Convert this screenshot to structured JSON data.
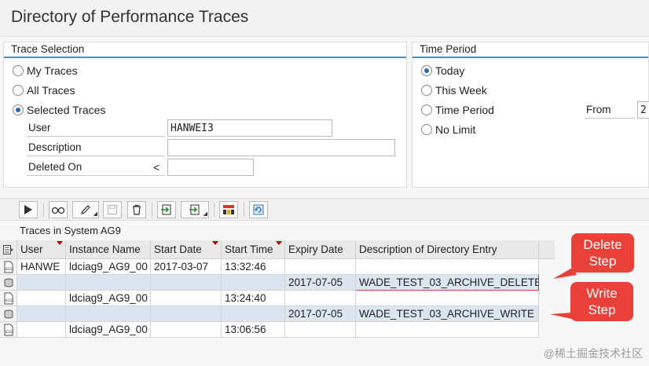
{
  "page": {
    "title": "Directory of Performance Traces"
  },
  "trace_selection": {
    "title": "Trace Selection",
    "options": [
      {
        "label": "My Traces",
        "checked": false
      },
      {
        "label": "All Traces",
        "checked": false
      },
      {
        "label": "Selected Traces",
        "checked": true
      }
    ],
    "fields": {
      "user_label": "User",
      "user_value": "HANWEI3",
      "description_label": "Description",
      "description_value": "",
      "deleted_on_label": "Deleted On",
      "deleted_on_operator": "<",
      "deleted_on_value": ""
    }
  },
  "time_period": {
    "title": "Time Period",
    "options": [
      {
        "label": "Today",
        "checked": true
      },
      {
        "label": "This Week",
        "checked": false
      },
      {
        "label": "Time Period",
        "checked": false
      },
      {
        "label": "No Limit",
        "checked": false
      }
    ],
    "from_label": "From",
    "from_value": "2"
  },
  "toolbar": {
    "buttons": [
      "execute-icon",
      "display-icon",
      "edit-icon",
      "save-icon",
      "delete-icon",
      "export-icon",
      "export-menu-icon",
      "layout-icon",
      "refresh-icon"
    ]
  },
  "traces": {
    "label": "Traces in System AG9",
    "columns": [
      "User",
      "Instance Name",
      "Start Date",
      "Start Time",
      "Expiry Date",
      "Description of Directory Entry"
    ],
    "rows": [
      {
        "user": "HANWE",
        "instance": "ldciag9_AG9_00",
        "start_date": "2017-03-07",
        "start_time": "13:32:46",
        "expiry": "",
        "description": "",
        "icon": "file-0110-icon"
      },
      {
        "user": "",
        "instance": "",
        "start_date": "",
        "start_time": "",
        "expiry": "2017-07-05",
        "description": "WADE_TEST_03_ARCHIVE_DELETE",
        "icon": "database-icon"
      },
      {
        "user": "",
        "instance": "ldciag9_AG9_00",
        "start_date": "",
        "start_time": "13:24:40",
        "expiry": "",
        "description": "",
        "icon": "file-0110-icon"
      },
      {
        "user": "",
        "instance": "",
        "start_date": "",
        "start_time": "",
        "expiry": "2017-07-05",
        "description": "WADE_TEST_03_ARCHIVE_WRITE",
        "icon": "database-icon"
      },
      {
        "user": "",
        "instance": "ldciag9_AG9_00",
        "start_date": "",
        "start_time": "13:06:56",
        "expiry": "",
        "description": "",
        "icon": "file-0110-icon"
      }
    ]
  },
  "callouts": {
    "delete": "Delete Step",
    "write": "Write Step"
  },
  "colors": {
    "accent": "#4a8fc3",
    "callout": "#e9403a",
    "row_highlight": "#dbe6f1"
  },
  "watermark": "@稀土掘金技术社区"
}
